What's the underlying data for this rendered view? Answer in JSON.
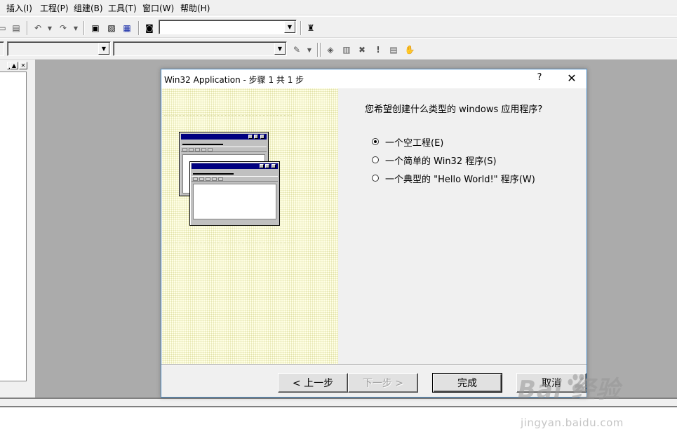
{
  "menubar": {
    "items": [
      "插入(I)",
      "工程(P)",
      "组建(B)",
      "工具(T)",
      "窗口(W)",
      "帮助(H)"
    ]
  },
  "toolbar": {
    "config_combo_value": "",
    "class_combo_value": "",
    "member_combo_value": ""
  },
  "dialog": {
    "title": "Win32 Application - 步骤 1 共 1 步",
    "help_glyph": "?",
    "close_glyph": "✕",
    "question": "您希望创建什么类型的 windows 应用程序?",
    "options": [
      {
        "label": "一个空工程(E)",
        "checked": true
      },
      {
        "label": "一个简单的  Win32  程序(S)",
        "checked": false
      },
      {
        "label": "一个典型的 \"Hello World!\" 程序(W)",
        "checked": false
      }
    ],
    "buttons": {
      "back": "< 上一步",
      "next": "下一步 >",
      "finish": "完成",
      "cancel": "取消"
    }
  },
  "watermark": {
    "brand": "Bai  经验",
    "url": "jingyan.baidu.com"
  },
  "colors": {
    "mdi_background": "#ababab",
    "wizard_panel": "#ffffe6",
    "mini_titlebar": "#000080",
    "dialog_border": "#4a8ac4"
  },
  "icons": [
    "cut-icon",
    "paste-icon",
    "undo-icon",
    "redo-icon",
    "workspace-icon",
    "output-icon",
    "window-list-icon",
    "find-in-files-icon",
    "find-icon",
    "wizard-action-icon",
    "compile-icon",
    "build-icon",
    "stop-build-icon",
    "execute-icon",
    "insert-breakpoint-icon",
    "go-icon"
  ]
}
